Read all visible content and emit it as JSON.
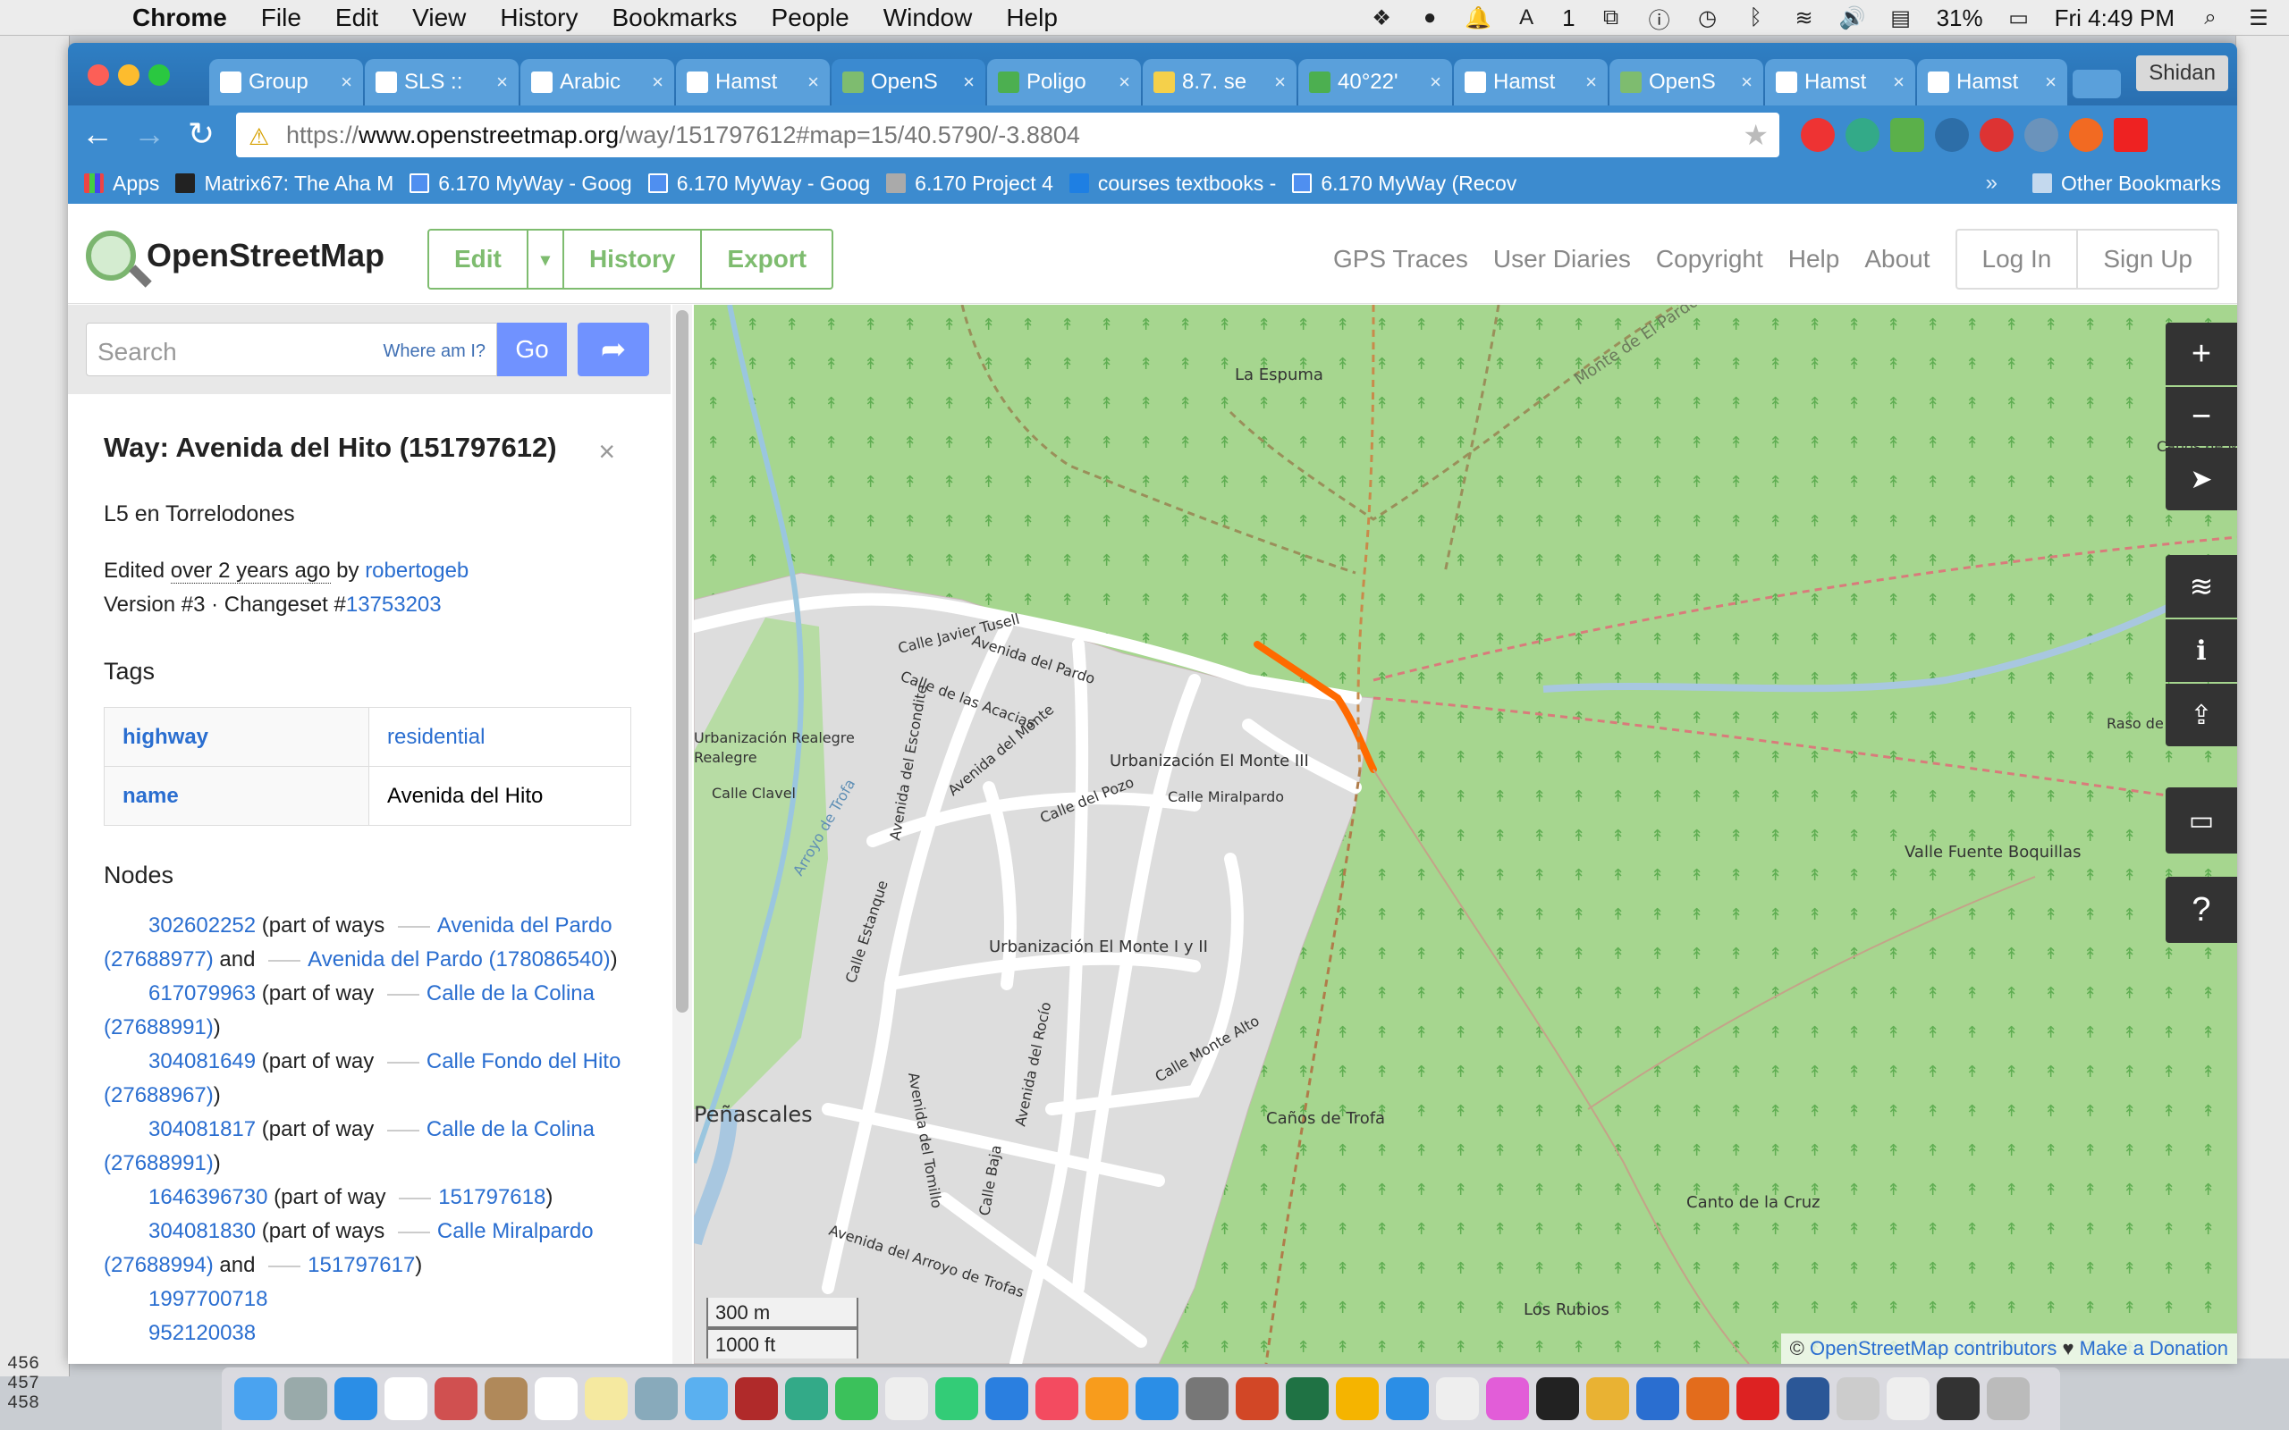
{
  "menubar": {
    "app": "Chrome",
    "items": [
      "File",
      "Edit",
      "View",
      "History",
      "Bookmarks",
      "People",
      "Window",
      "Help"
    ],
    "battery": "31%",
    "clock": "Fri 4:49 PM",
    "notification_count": "1"
  },
  "spreadsheet_rows": [
    "456",
    "457",
    "458"
  ],
  "browser": {
    "tabs": [
      {
        "title": "Group"
      },
      {
        "title": "SLS ::"
      },
      {
        "title": "Arabic"
      },
      {
        "title": "Hamst"
      },
      {
        "title": "OpenS",
        "active": true
      },
      {
        "title": "Poligo"
      },
      {
        "title": "8.7. se"
      },
      {
        "title": "40°22'"
      },
      {
        "title": "Hamst"
      },
      {
        "title": "OpenS"
      },
      {
        "title": "Hamst"
      },
      {
        "title": "Hamst"
      }
    ],
    "profile": "Shidan",
    "url_prefix": "https://",
    "url_domain": "www.openstreetmap.org",
    "url_path": "/way/151797612#map=15/40.5790/-3.8804",
    "bookmarks": [
      "Apps",
      "Matrix67: The Aha M",
      "6.170 MyWay - Goog",
      "6.170 MyWay - Goog",
      "6.170 Project 4",
      "courses textbooks -",
      "6.170 MyWay (Recov"
    ],
    "other_bookmarks": "Other Bookmarks"
  },
  "osm": {
    "brand": "OpenStreetMap",
    "edit": "Edit",
    "history": "History",
    "export": "Export",
    "nav": [
      "GPS Traces",
      "User Diaries",
      "Copyright",
      "Help",
      "About"
    ],
    "login": "Log In",
    "signup": "Sign Up",
    "search_placeholder": "Search",
    "where_am_i": "Where am I?",
    "go": "Go"
  },
  "way": {
    "title": "Way: Avenida del Hito (151797612)",
    "subtitle": "L5 en Torrelodones",
    "edited_prefix": "Edited ",
    "edited_time": "over 2 years ago",
    "edited_by": " by ",
    "user": "robertogeb",
    "version_prefix": "Version #3 · Changeset #",
    "changeset": "13753203",
    "tags_heading": "Tags",
    "tags": [
      {
        "key": "highway",
        "value": "residential"
      },
      {
        "key": "name",
        "value": "Avenida del Hito"
      }
    ],
    "nodes_heading": "Nodes",
    "nodes": [
      {
        "id": "302602252",
        "pre": " (part of ways ",
        "w1": "Avenida del Pardo (27688977)",
        "mid": " and ",
        "w2": "Avenida del Pardo (178086540)",
        "post": ")"
      },
      {
        "id": "617079963",
        "pre": " (part of way ",
        "w1": "Calle de la Colina (27688991)",
        "mid": "",
        "w2": "",
        "post": ")"
      },
      {
        "id": "304081649",
        "pre": " (part of way ",
        "w1": "Calle Fondo del Hito (27688967)",
        "mid": "",
        "w2": "",
        "post": ")"
      },
      {
        "id": "304081817",
        "pre": " (part of way ",
        "w1": "Calle de la Colina (27688991)",
        "mid": "",
        "w2": "",
        "post": ")"
      },
      {
        "id": "1646396730",
        "pre": " (part of way ",
        "w1": "151797618",
        "mid": "",
        "w2": "",
        "post": ")"
      },
      {
        "id": "304081830",
        "pre": " (part of ways ",
        "w1": "Calle Miralpardo (27688994)",
        "mid": " and ",
        "w2": "151797617",
        "post": ")"
      },
      {
        "id": "1997700718",
        "pre": "",
        "w1": "",
        "mid": "",
        "w2": "",
        "post": ""
      },
      {
        "id": "952120038",
        "pre": "",
        "w1": "",
        "mid": "",
        "w2": "",
        "post": ""
      }
    ]
  },
  "map": {
    "labels": [
      "La Espuma",
      "Monte de El Pardo",
      "Caños de M",
      "Raso de la Perdiguera",
      "Valle Fuente Boquillas",
      "Urbanización El Monte III",
      "Urbanización El Monte I y II",
      "Calle Miralpardo",
      "Avenida del Pardo",
      "Calle de las Acacias",
      "Calle Javier Tusell",
      "Avenida del Escondite",
      "Avenida del Monte",
      "Calle del Pozo",
      "Calle Clavel",
      "Arroyo de Trofa",
      "Calle Estanque",
      "Avenida del Tomillo",
      "Avenida del Rocío",
      "Calle Baja",
      "Calle Monte Alto",
      "Caños de Trofa",
      "Peñascales",
      "Avenida del Arroyo de Trofas",
      "Canto de la Cruz",
      "Los Rubios",
      "Urbanización Realegre",
      "Realegre"
    ],
    "scale_m": "300 m",
    "scale_ft": "1000 ft",
    "attrib_copy": "© ",
    "attrib_link": "OpenStreetMap contributors",
    "attrib_heart": " ♥ ",
    "attrib_donate": "Make a Donation",
    "colors": {
      "forest": "#a6d68f",
      "residential": "#dddddd",
      "road": "#ffffff",
      "highlight": "#ff6a00"
    }
  }
}
